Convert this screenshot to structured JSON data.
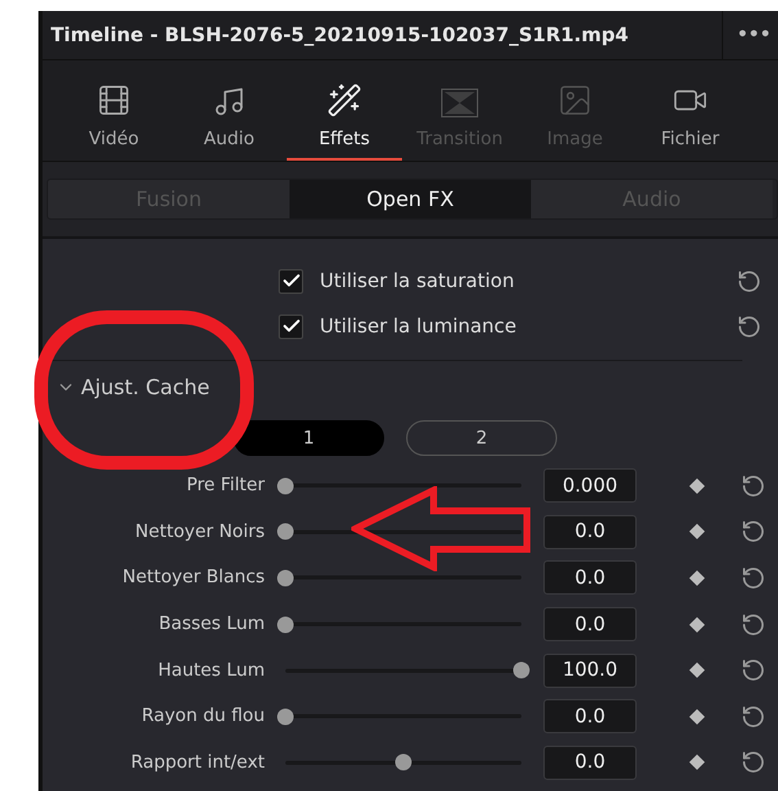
{
  "window": {
    "title": "Timeline - BLSH-2076-5_20210915-102037_S1R1.mp4",
    "menu": "•••"
  },
  "tabs": [
    {
      "label": "Vidéo",
      "kind": "film",
      "selected": false,
      "disabled": false
    },
    {
      "label": "Audio",
      "kind": "music",
      "selected": false,
      "disabled": false
    },
    {
      "label": "Effets",
      "kind": "wand",
      "selected": true,
      "disabled": false
    },
    {
      "label": "Transition",
      "kind": "transition",
      "selected": false,
      "disabled": true
    },
    {
      "label": "Image",
      "kind": "image",
      "selected": false,
      "disabled": true
    },
    {
      "label": "Fichier",
      "kind": "camera",
      "selected": false,
      "disabled": false
    }
  ],
  "subtabs": [
    {
      "label": "Fusion",
      "selected": false
    },
    {
      "label": "Open FX",
      "selected": true
    },
    {
      "label": "Audio",
      "selected": false
    }
  ],
  "options": [
    {
      "label": "Utiliser la saturation",
      "checked": true
    },
    {
      "label": "Utiliser la luminance",
      "checked": true
    }
  ],
  "section": {
    "title": "Ajust. Cache",
    "expanded": true
  },
  "toggles": [
    {
      "label": "1",
      "selected": true
    },
    {
      "label": "2",
      "selected": false
    }
  ],
  "sliders": [
    {
      "name": "Pre Filter",
      "level": 0,
      "value": "0.000"
    },
    {
      "name": "Nettoyer Noirs",
      "level": 0,
      "value": "0.0"
    },
    {
      "name": "Nettoyer Blancs",
      "level": 0,
      "value": "0.0"
    },
    {
      "name": "Basses Lum",
      "level": 0,
      "value": "0.0"
    },
    {
      "name": "Hautes Lum",
      "level": 1,
      "value": "100.0"
    },
    {
      "name": "Rayon du flou",
      "level": 0,
      "value": "0.0"
    },
    {
      "name": "Rapport int/ext",
      "level": 0.5,
      "value": "0.0"
    }
  ]
}
